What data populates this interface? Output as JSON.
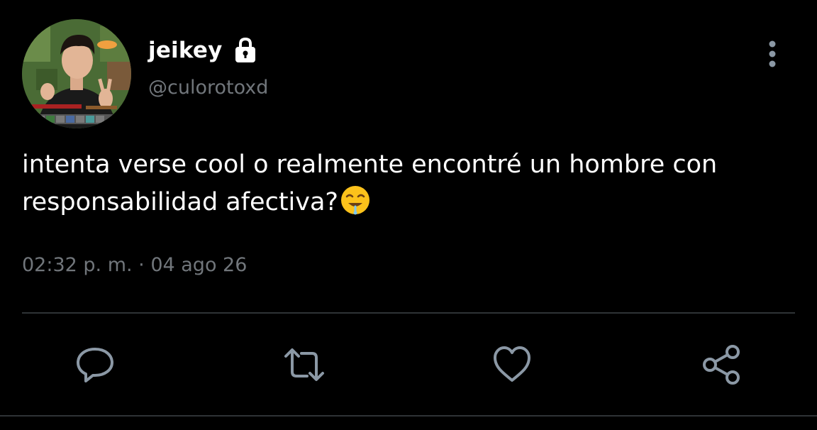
{
  "user": {
    "display_name": "jeikey",
    "handle": "@culorotoxd",
    "protected_icon": "lock-icon",
    "avatar_icon": "avatar-photo"
  },
  "tweet": {
    "text": "intenta verse cool o realmente encontré un hombre con responsabilidad afectiva?",
    "emoji_icon": "drooling-face-emoji",
    "timestamp": "02:32 p. m. · 04 ago 26"
  },
  "actions": {
    "reply_icon": "reply-icon",
    "retweet_icon": "retweet-icon",
    "like_icon": "heart-icon",
    "share_icon": "share-icon",
    "more_icon": "more-vertical-icon"
  },
  "colors": {
    "background": "#000000",
    "text_primary": "#ffffff",
    "text_secondary": "#71767b",
    "icon": "#8b98a5",
    "divider": "#2f3336"
  }
}
